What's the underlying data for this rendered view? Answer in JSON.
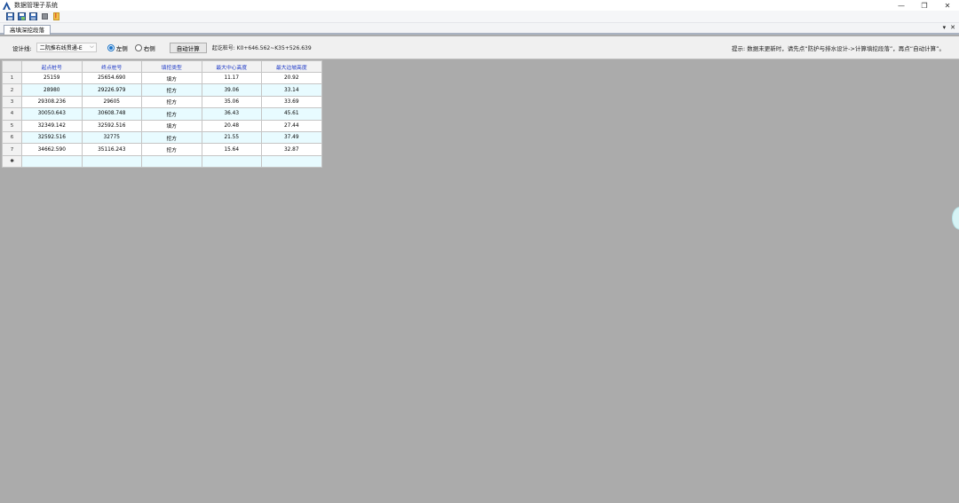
{
  "app": {
    "title": "数据管理子系统",
    "window_controls": [
      "—",
      "❐",
      "✕"
    ]
  },
  "toolbar": {
    "icons": [
      "save-icon",
      "save-as-icon",
      "save-all-icon",
      "print-icon",
      "bookmark-icon"
    ]
  },
  "tabs": [
    {
      "label": "高填深挖段落",
      "active": true
    }
  ],
  "tab_controls": {
    "dropdown": "▾",
    "close": "✕"
  },
  "options": {
    "design_line_label": "设计线:",
    "design_line_value": "二阮推右线贯通-E",
    "left_label": "左侧",
    "right_label": "右侧",
    "left_checked": true,
    "auto_calc_label": "自动计算",
    "range_text": "起讫桩号: K0+646.562~K35+526.639",
    "hint_text": "提示: 数据未更新时，请先点“防护与排水设计->计算填挖段落”，再点“自动计算”。"
  },
  "grid": {
    "columns": [
      "起点桩号",
      "终点桩号",
      "填挖类型",
      "最大中心高度",
      "最大边坡高度"
    ],
    "rows": [
      {
        "n": "1",
        "cells": [
          "25159",
          "25654.690",
          "填方",
          "11.17",
          "20.92"
        ]
      },
      {
        "n": "2",
        "cells": [
          "28980",
          "29226.979",
          "挖方",
          "39.06",
          "33.14"
        ]
      },
      {
        "n": "3",
        "cells": [
          "29308.236",
          "29605",
          "挖方",
          "35.06",
          "33.69"
        ]
      },
      {
        "n": "4",
        "cells": [
          "30050.643",
          "30608.748",
          "挖方",
          "36.43",
          "45.61"
        ]
      },
      {
        "n": "5",
        "cells": [
          "32349.142",
          "32592.516",
          "填方",
          "20.48",
          "27.44"
        ]
      },
      {
        "n": "6",
        "cells": [
          "32592.516",
          "32775",
          "挖方",
          "21.55",
          "37.49"
        ]
      },
      {
        "n": "7",
        "cells": [
          "34662.590",
          "35116.243",
          "挖方",
          "15.64",
          "32.87"
        ]
      }
    ],
    "new_row_marker": "✱"
  },
  "colors": {
    "header_text": "#1c38c7",
    "alt_row": "#e8fbff",
    "workspace": "#ababab",
    "radio_accent": "#1a73c8"
  }
}
